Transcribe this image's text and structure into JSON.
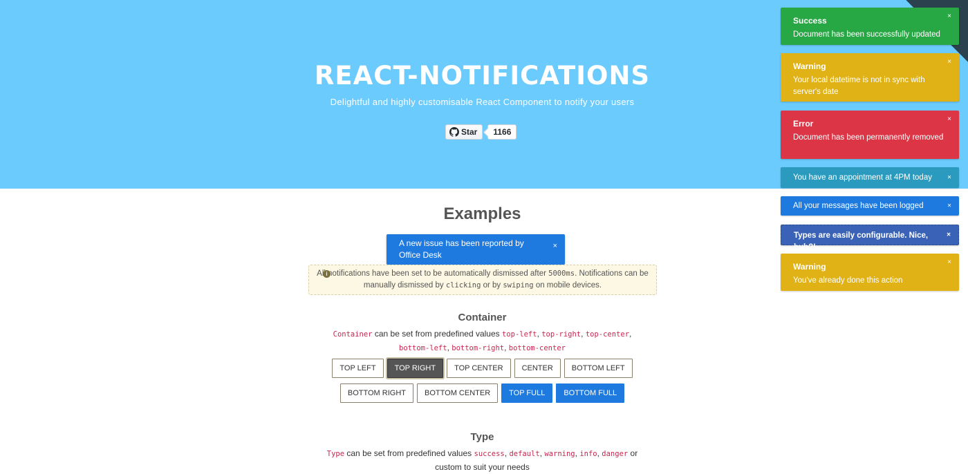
{
  "hero": {
    "title": "REACT-NOTIFICATIONS",
    "subtitle": "Delightful and highly customisable React Component to notify your users",
    "star_label": "Star",
    "star_count": "1166"
  },
  "main": {
    "examples_title": "Examples",
    "center_notification": {
      "message": "A new issue has been reported by Office Desk",
      "close": "×"
    },
    "info": {
      "icon": "info-icon",
      "text_1": "All notifications have been set to be automatically dismissed after ",
      "duration": "5000ms",
      "text_2": ". Notifications can be manually dismissed by ",
      "clicking": "clicking",
      "text_3": " or by ",
      "swiping": "swiping",
      "text_4": " on mobile devices."
    },
    "container": {
      "heading": "Container",
      "code_name": "Container",
      "text": " can be set from predefined values ",
      "values": [
        "top-left",
        "top-right",
        "top-center",
        "bottom-left",
        "bottom-right",
        "bottom-center"
      ],
      "buttons_row1": [
        "TOP LEFT",
        "TOP RIGHT",
        "TOP CENTER",
        "CENTER",
        "BOTTOM LEFT"
      ],
      "buttons_row2": [
        "BOTTOM RIGHT",
        "BOTTOM CENTER",
        "TOP FULL",
        "BOTTOM FULL"
      ]
    },
    "type": {
      "heading": "Type",
      "code_name": "Type",
      "text": " can be set from predefined values ",
      "values": [
        "success",
        "default",
        "warning",
        "info",
        "danger"
      ],
      "or_text": " or",
      "line2": "custom to suit your needs"
    }
  },
  "notifications": [
    {
      "title": "Success",
      "message": "Document has been successfully updated",
      "color": "#28a745",
      "close": "×"
    },
    {
      "title": "Warning",
      "message": "Your local datetime is not in sync with server's date",
      "color": "#e0b215",
      "close": "×"
    },
    {
      "title": "Error",
      "message": "Document has been permanently removed",
      "color": "#dc3545",
      "close": "×"
    },
    {
      "title": "",
      "message": "You have an appointment at 4PM today",
      "color": "#2a9bbf",
      "close": "×"
    },
    {
      "title": "",
      "message": "All your messages have been logged",
      "color": "#1f7ae0",
      "close": "×"
    },
    {
      "title": "",
      "message": "Types are easily configurable. Nice, huh?!",
      "color": "#3a63b8",
      "close": "×"
    },
    {
      "title": "Warning",
      "message": "You've already done this action",
      "color": "#e0b215",
      "close": "×"
    }
  ]
}
